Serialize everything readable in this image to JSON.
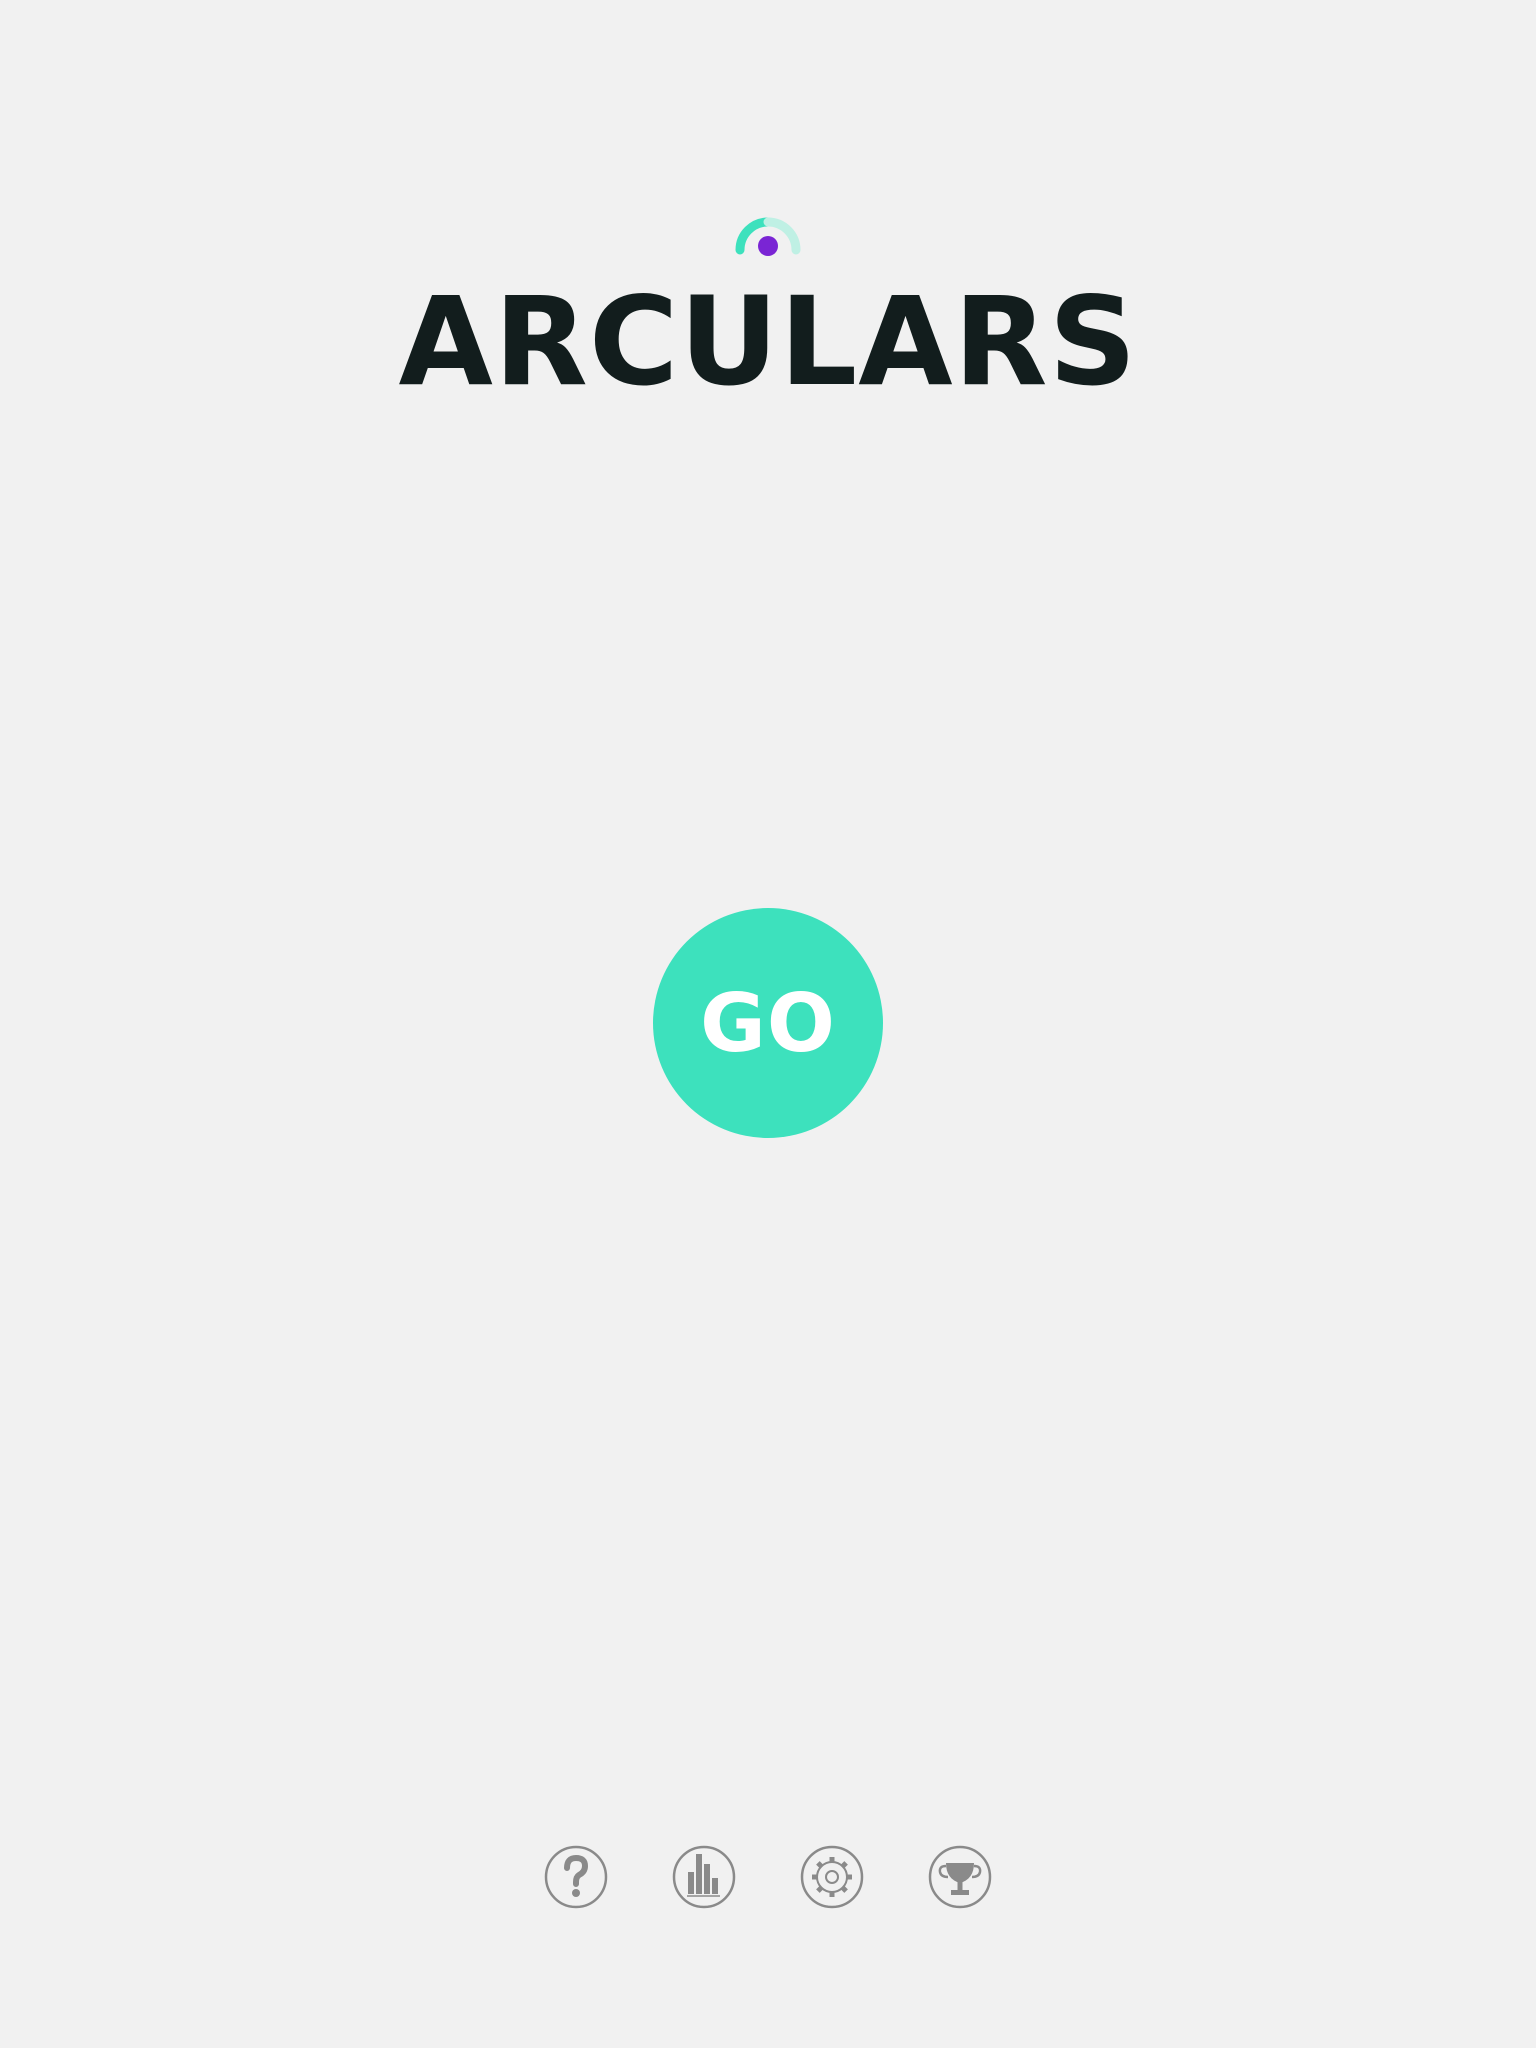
{
  "app": {
    "title": "ARCULARS"
  },
  "colors": {
    "background": "#f1f1f1",
    "accent": "#3de1bd",
    "accent_light": "#bff0e4",
    "dot": "#7a25d4",
    "title_text": "#121d1d",
    "icon_gray": "#8a8a8a"
  },
  "logo": {
    "icon": "arc-dot-logo-icon"
  },
  "play": {
    "label": "GO"
  },
  "bottom_nav": [
    {
      "icon": "help-icon"
    },
    {
      "icon": "stats-icon"
    },
    {
      "icon": "settings-icon"
    },
    {
      "icon": "trophy-icon"
    }
  ]
}
